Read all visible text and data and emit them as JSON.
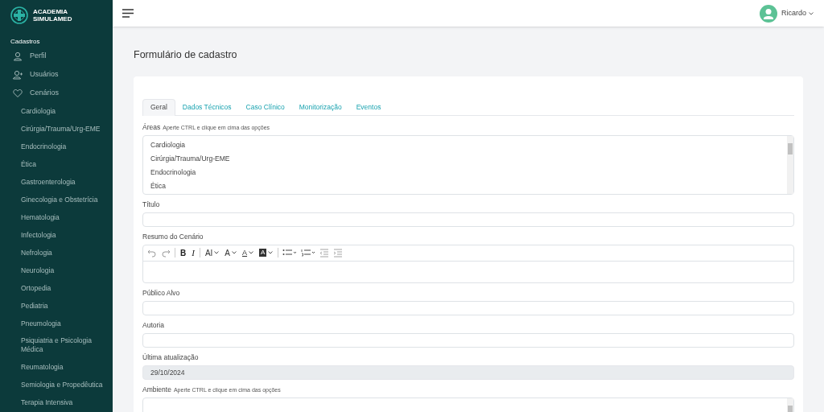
{
  "brand": {
    "line1": "ACADEMIA",
    "line2": "SIMULAMED"
  },
  "sidebar": {
    "section": "Cadastros",
    "items": [
      {
        "label": "Perfil"
      },
      {
        "label": "Usuários"
      },
      {
        "label": "Cenários",
        "children": [
          {
            "label": "Cardiologia"
          },
          {
            "label": "Cirúrgia/Trauma/Urg-EME"
          },
          {
            "label": "Endocrinologia"
          },
          {
            "label": "Ética"
          },
          {
            "label": "Gastroenterologia"
          },
          {
            "label": "Ginecologia e Obstetrícia"
          },
          {
            "label": "Hematologia"
          },
          {
            "label": "Infectologia"
          },
          {
            "label": "Nefrologia"
          },
          {
            "label": "Neurologia"
          },
          {
            "label": "Ortopedia"
          },
          {
            "label": "Pediatria"
          },
          {
            "label": "Pneumologia"
          },
          {
            "label": "Psiquiatria e Psicologia Médica"
          },
          {
            "label": "Reumatologia"
          },
          {
            "label": "Semiologia e Propedêutica"
          },
          {
            "label": "Terapia Intensiva"
          }
        ]
      }
    ]
  },
  "user": {
    "name": "Ricardo"
  },
  "page_title": "Formulário de cadastro",
  "tabs": [
    {
      "label": "Geral",
      "selected": true
    },
    {
      "label": "Dados Técnicos",
      "selected": false
    },
    {
      "label": "Caso Clínico",
      "selected": false
    },
    {
      "label": "Monitorização",
      "selected": false
    },
    {
      "label": "Eventos",
      "selected": false
    }
  ],
  "fields": [
    {
      "kind": "listbox",
      "label": "Áreas",
      "hint": "Aperte CTRL e clique em cima das opções",
      "options": [
        "Cardiologia",
        "Cirúrgia/Trauma/Urg-EME",
        "Endocrinologia",
        "Ética"
      ]
    },
    {
      "kind": "text",
      "label": "Título",
      "disabled": false
    },
    {
      "kind": "editor",
      "label": "Resumo do Cenário",
      "toolbar": [
        {
          "kind": "undo"
        },
        {
          "kind": "redo"
        },
        {
          "kind": "sep"
        },
        {
          "kind": "bold",
          "label": "B"
        },
        {
          "kind": "italic",
          "label": "I"
        },
        {
          "kind": "sep"
        },
        {
          "kind": "size",
          "label": "AI"
        },
        {
          "kind": "super",
          "label": "A"
        },
        {
          "kind": "color",
          "label": "A"
        },
        {
          "kind": "highlight",
          "label": "A"
        },
        {
          "kind": "sep"
        },
        {
          "kind": "bullets"
        },
        {
          "kind": "numbers"
        },
        {
          "kind": "outdent"
        },
        {
          "kind": "indent"
        }
      ]
    },
    {
      "kind": "text",
      "label": "Público Alvo",
      "disabled": false
    },
    {
      "kind": "text",
      "label": "Autoria",
      "disabled": false
    },
    {
      "kind": "text",
      "label": "Última atualização",
      "disabled": true,
      "value": "29/10/2024"
    },
    {
      "kind": "listbox",
      "label": "Ambiente",
      "hint": "Aperte CTRL e clique em cima das opções"
    }
  ]
}
